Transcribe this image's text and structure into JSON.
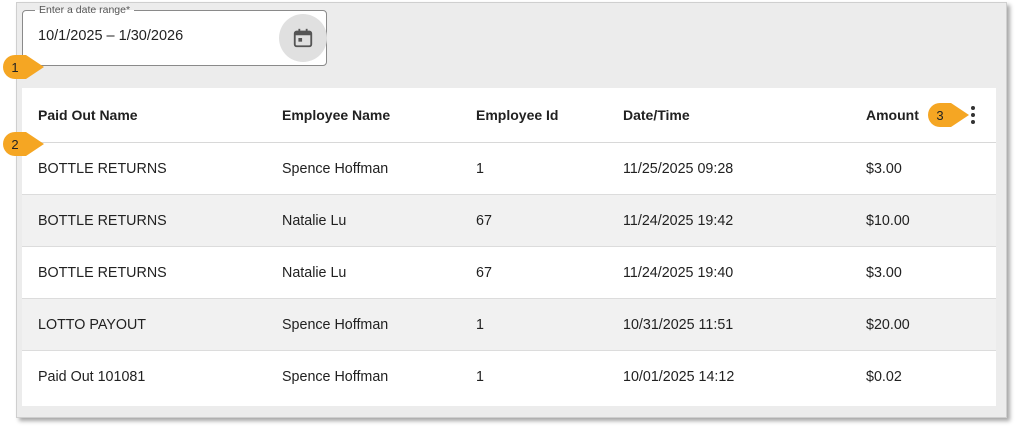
{
  "date_range": {
    "label": "Enter a date range*",
    "value": "10/1/2025 – 1/30/2026",
    "calendar_icon": "calendar-icon"
  },
  "table": {
    "headers": {
      "paid_out_name": "Paid Out Name",
      "employee_name": "Employee Name",
      "employee_id": "Employee Id",
      "date_time": "Date/Time",
      "amount": "Amount"
    },
    "menu_icon": "more-vert-icon",
    "rows": [
      {
        "paid_out_name": "BOTTLE RETURNS",
        "employee_name": "Spence Hoffman",
        "employee_id": "1",
        "date_time": "11/25/2025 09:28",
        "amount": "$3.00"
      },
      {
        "paid_out_name": "BOTTLE RETURNS",
        "employee_name": "Natalie Lu",
        "employee_id": "67",
        "date_time": "11/24/2025 19:42",
        "amount": "$10.00"
      },
      {
        "paid_out_name": "BOTTLE RETURNS",
        "employee_name": "Natalie Lu",
        "employee_id": "67",
        "date_time": "11/24/2025 19:40",
        "amount": "$3.00"
      },
      {
        "paid_out_name": "LOTTO PAYOUT",
        "employee_name": "Spence Hoffman",
        "employee_id": "1",
        "date_time": "10/31/2025 11:51",
        "amount": "$20.00"
      },
      {
        "paid_out_name": "Paid Out 101081",
        "employee_name": "Spence Hoffman",
        "employee_id": "1",
        "date_time": "10/01/2025 14:12",
        "amount": "$0.02"
      }
    ]
  },
  "callouts": [
    "1",
    "2",
    "3"
  ],
  "colors": {
    "callout": "#f5a623",
    "panel": "#ececec",
    "alt_row": "#f1f1f1"
  }
}
